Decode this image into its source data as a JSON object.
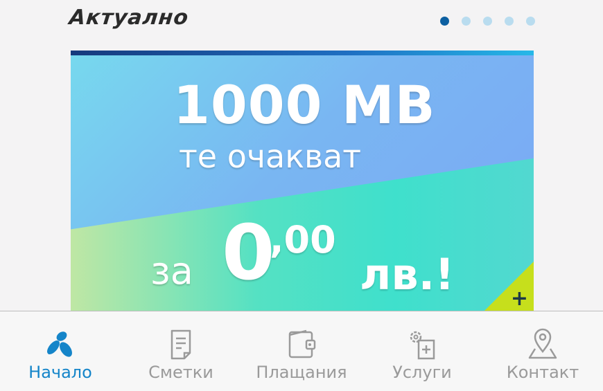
{
  "section": {
    "title": "Актуално"
  },
  "carousel": {
    "total": 5,
    "active_index": 0
  },
  "banner": {
    "headline": "1000 MB",
    "subline": "те очакват",
    "price_prefix": "за",
    "price_main": "0",
    "price_decimal": ",00",
    "price_suffix": "лв.!",
    "corner_plus": "+"
  },
  "nav": {
    "items": [
      {
        "label": "Начало",
        "icon": "telenor-logo-icon",
        "active": true
      },
      {
        "label": "Сметки",
        "icon": "bill-icon",
        "active": false
      },
      {
        "label": "Плащания",
        "icon": "wallet-icon",
        "active": false
      },
      {
        "label": "Услуги",
        "icon": "services-icon",
        "active": false
      },
      {
        "label": "Контакт",
        "icon": "location-pin-icon",
        "active": false
      }
    ]
  },
  "colors": {
    "accent": "#1585c9",
    "active_dot": "#0c5fa1",
    "inactive_dot": "#b9dcef",
    "corner": "#c6df1c"
  }
}
